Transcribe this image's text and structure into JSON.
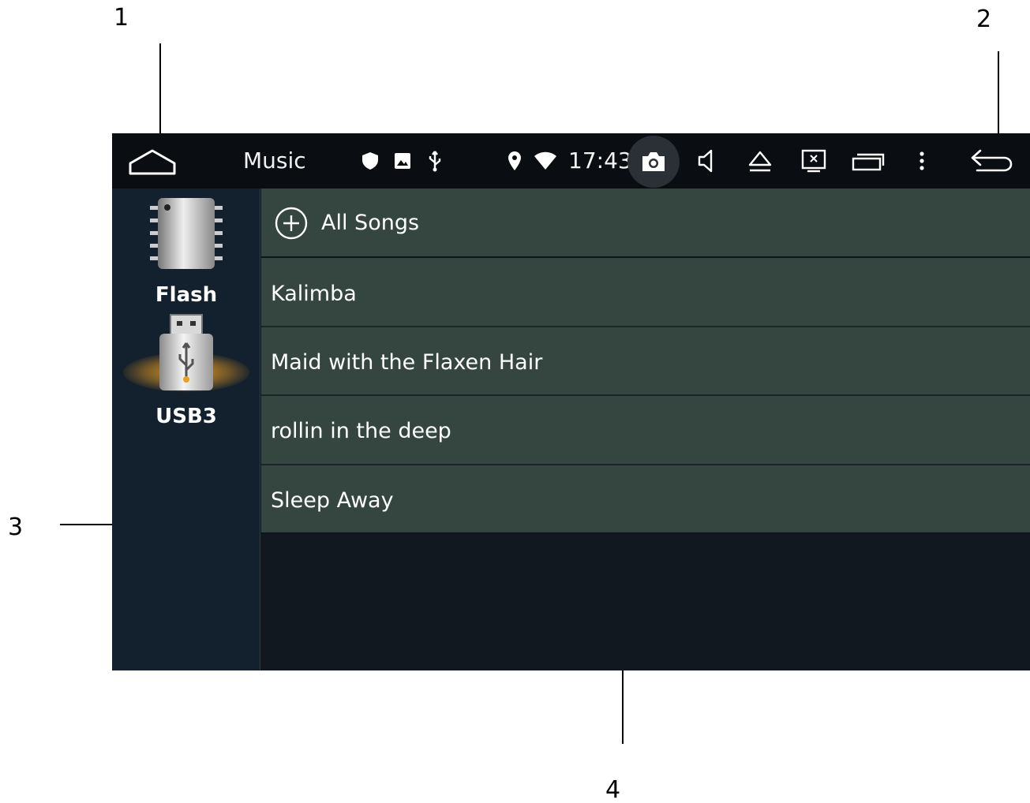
{
  "callouts": [
    "1",
    "2",
    "3",
    "4"
  ],
  "statusbar": {
    "title": "Music",
    "time": "17:43",
    "icons": [
      "home-icon",
      "shield-icon",
      "image-icon",
      "usb-icon",
      "location-icon",
      "wifi-icon",
      "camera-icon",
      "volume-icon",
      "eject-icon",
      "screen-off-icon",
      "recent-apps-icon",
      "more-icon",
      "back-icon"
    ]
  },
  "sidebar": {
    "sources": [
      {
        "label": "Flash",
        "icon": "flash-memory-icon"
      },
      {
        "label": "USB3",
        "icon": "usb-drive-icon"
      }
    ]
  },
  "list": {
    "all_songs_label": "All Songs",
    "songs": [
      "Kalimba",
      "Maid with the Flaxen Hair",
      "rollin in the deep",
      "Sleep Away"
    ]
  },
  "colors": {
    "statusbar_bg": "#0a0d12",
    "sidebar_bg": "#13202d",
    "row_bg": "#34463f",
    "usb_glow": "#f0a020"
  }
}
